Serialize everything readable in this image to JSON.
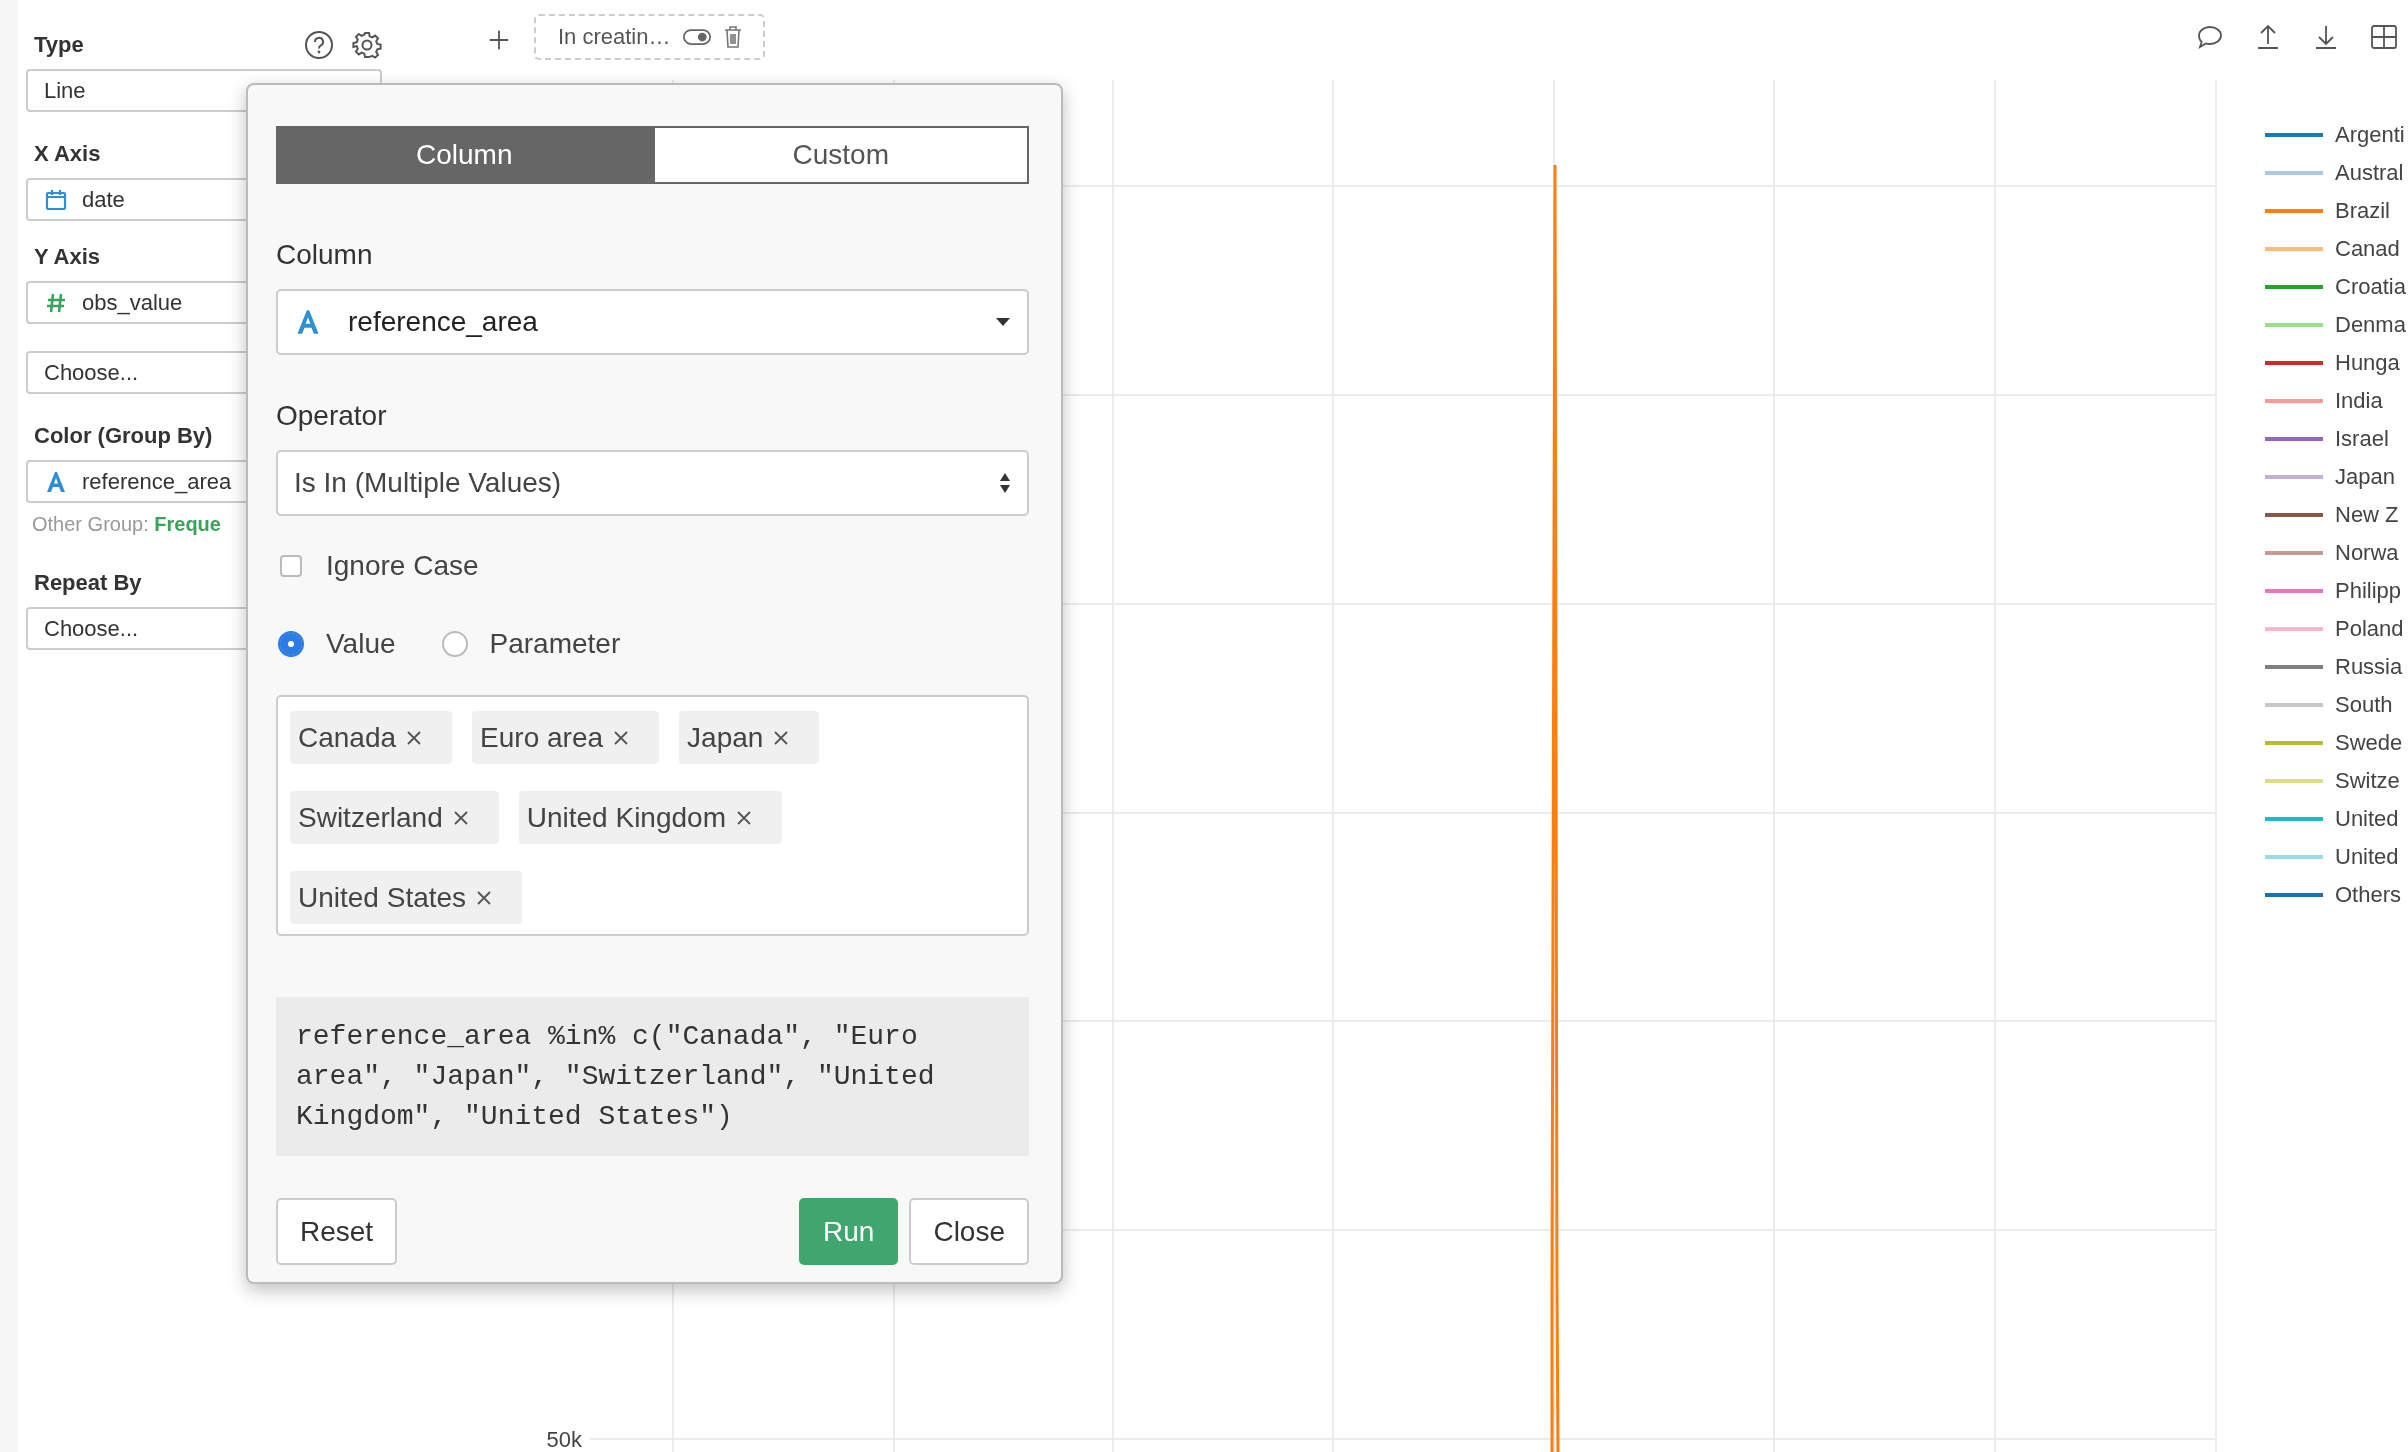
{
  "sidebar": {
    "type": {
      "label": "Type",
      "value": "Line"
    },
    "x_axis": {
      "label": "X Axis",
      "value": "date",
      "kind": "date"
    },
    "y_axis": {
      "label": "Y Axis",
      "value": "obs_value",
      "kind": "number",
      "extra": "Choose..."
    },
    "color": {
      "label": "Color (Group By)",
      "value": "reference_area",
      "kind": "text",
      "note_label": "Other Group:",
      "note_value": "Freque"
    },
    "repeat": {
      "label": "Repeat By",
      "value": "Choose..."
    }
  },
  "toolbar": {
    "draft_tab": "In creatin…"
  },
  "dialog": {
    "tabs": [
      {
        "label": "Column",
        "selected": true
      },
      {
        "label": "Custom",
        "selected": false
      }
    ],
    "column": {
      "label": "Column",
      "value": "reference_area",
      "kind": "text"
    },
    "operator": {
      "label": "Operator",
      "value": "Is In (Multiple Values)"
    },
    "ignore_case": {
      "label": "Ignore Case",
      "checked": false
    },
    "modes": [
      {
        "label": "Value",
        "selected": true
      },
      {
        "label": "Parameter",
        "selected": false
      }
    ],
    "values": [
      "Canada",
      "Euro area",
      "Japan",
      "Switzerland",
      "United Kingdom",
      "United States"
    ],
    "expression": "reference_area %in% c(\"Canada\", \"Euro area\", \"Japan\", \"Switzerland\", \"United Kingdom\", \"United States\")",
    "buttons": {
      "reset": "Reset",
      "run": "Run",
      "close": "Close"
    }
  },
  "chart": {
    "y_tick": "50k"
  },
  "legend": [
    {
      "label": "Argenti",
      "color": "#1f77b4"
    },
    {
      "label": "Austral",
      "color": "#aec7e8"
    },
    {
      "label": "Brazil",
      "color": "#ff7f0e"
    },
    {
      "label": "Canad",
      "color": "#ffbb78"
    },
    {
      "label": "Croatia",
      "color": "#2ca02c"
    },
    {
      "label": "Denma",
      "color": "#98df8a"
    },
    {
      "label": "Hunga",
      "color": "#d62728"
    },
    {
      "label": "India",
      "color": "#ff9896"
    },
    {
      "label": "Israel",
      "color": "#9467bd"
    },
    {
      "label": "Japan",
      "color": "#c5b0d5"
    },
    {
      "label": "New Z",
      "color": "#8c564b"
    },
    {
      "label": "Norwa",
      "color": "#c49c94"
    },
    {
      "label": "Philipp",
      "color": "#e377c2"
    },
    {
      "label": "Poland",
      "color": "#f7b6d2"
    },
    {
      "label": "Russia",
      "color": "#7f7f7f"
    },
    {
      "label": "South",
      "color": "#c7c7c7"
    },
    {
      "label": "Swede",
      "color": "#bcbd22"
    },
    {
      "label": "Switze",
      "color": "#dbdb8d"
    },
    {
      "label": "United",
      "color": "#17becf"
    },
    {
      "label": "United",
      "color": "#9edae5"
    },
    {
      "label": "Others",
      "color": "#1f6fb0"
    }
  ]
}
